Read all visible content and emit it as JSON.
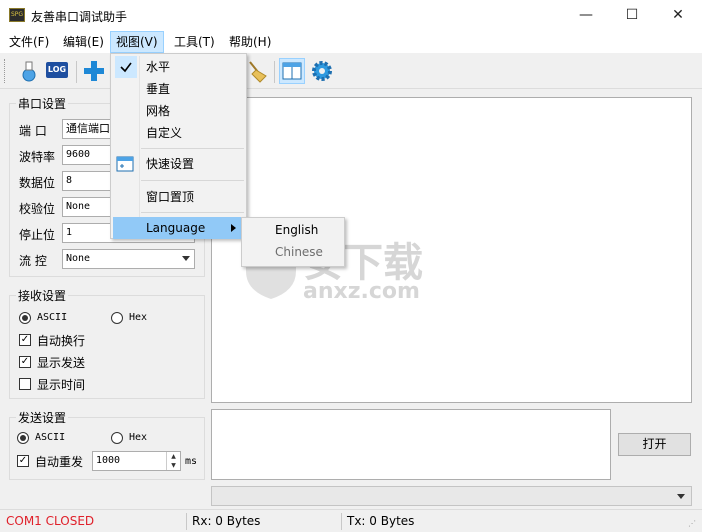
{
  "window": {
    "title": "友善串口调试助手",
    "app_icon_text": "SPG",
    "min": "—",
    "max": "☐",
    "close": "✕"
  },
  "menubar": [
    "文件(F)",
    "编辑(E)",
    "视图(V)",
    "工具(T)",
    "帮助(H)"
  ],
  "toolbar": {
    "log_label": "LOG"
  },
  "view_menu": {
    "items": [
      "水平",
      "垂直",
      "网格",
      "自定义",
      "快速设置",
      "窗口置顶",
      "Language"
    ],
    "checked": "水平",
    "highlighted": "Language"
  },
  "language_submenu": [
    "English",
    "Chinese"
  ],
  "serial_settings": {
    "title": "串口设置",
    "rows": [
      {
        "label": "端  口",
        "value": "通信端口"
      },
      {
        "label": "波特率",
        "value": "9600"
      },
      {
        "label": "数据位",
        "value": "8"
      },
      {
        "label": "校验位",
        "value": "None"
      },
      {
        "label": "停止位",
        "value": "1"
      },
      {
        "label": "流  控",
        "value": "None"
      }
    ]
  },
  "receive_settings": {
    "title": "接收设置",
    "mode_ascii": "ASCII",
    "mode_hex": "Hex",
    "mode_selected": "ASCII",
    "options": [
      {
        "label": "自动换行",
        "checked": true
      },
      {
        "label": "显示发送",
        "checked": true
      },
      {
        "label": "显示时间",
        "checked": false
      }
    ]
  },
  "send_settings": {
    "title": "发送设置",
    "mode_ascii": "ASCII",
    "mode_hex": "Hex",
    "mode_selected": "ASCII",
    "auto_resend_label": "自动重发",
    "auto_resend_checked": true,
    "interval": "1000",
    "interval_unit": "ms"
  },
  "open_button": "打开",
  "status": {
    "port": "COM1 CLOSED",
    "rx": "Rx: 0 Bytes",
    "tx": "Tx: 0 Bytes"
  },
  "watermark": {
    "title": "安下载",
    "url": "anxz.com"
  },
  "colors": {
    "status_port": "#e0202a",
    "menu_highlight": "#91c9f7",
    "menu_active": "#cce8ff",
    "icon_blue": "#1e88d6"
  }
}
